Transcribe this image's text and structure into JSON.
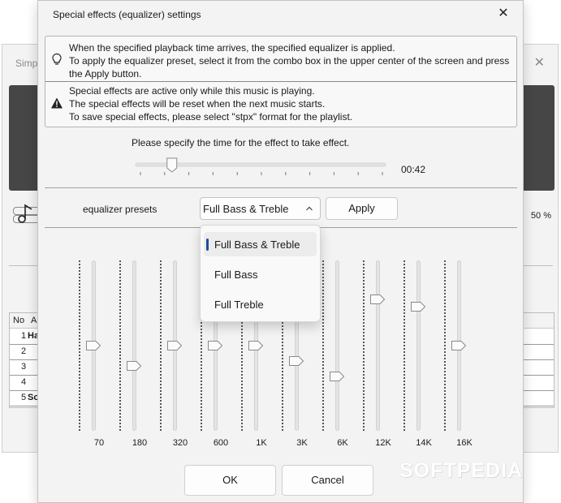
{
  "background_window": {
    "title": "Simpl",
    "close_glyph": "✕",
    "volume_percent": "50 %",
    "table": {
      "headers": [
        "No",
        "Ar"
      ],
      "rows": [
        {
          "no": "1",
          "name": "Ha"
        },
        {
          "no": "2",
          "name": ""
        },
        {
          "no": "3",
          "name": ""
        },
        {
          "no": "4",
          "name": ""
        },
        {
          "no": "5",
          "name": "So"
        }
      ]
    }
  },
  "dialog": {
    "title": "Special effects (equalizer) settings",
    "close_glyph": "✕",
    "info": {
      "section1": [
        "When the specified playback time arrives, the specified equalizer is applied.",
        "To apply the equalizer preset, select it from the combo box in the upper center of the screen and press",
        "the Apply button."
      ],
      "section2": [
        "Special effects are active only while this music is playing.",
        "The special effects will be reset when the next music starts.",
        "To save special effects, please select \"stpx\" format for the playlist."
      ]
    },
    "time": {
      "label": "Please specify the time for the effect to take effect.",
      "value": "00:42",
      "slider_fraction": 0.13
    },
    "preset": {
      "label": "equalizer presets",
      "selected": "Full Bass & Treble",
      "apply_label": "Apply",
      "options": [
        "Full Bass & Treble",
        "Full Bass",
        "Full Treble"
      ]
    },
    "equalizer": {
      "bands": [
        {
          "label": "70",
          "level": 0.5
        },
        {
          "label": "180",
          "level": 0.38
        },
        {
          "label": "320",
          "level": 0.5
        },
        {
          "label": "600",
          "level": 0.5
        },
        {
          "label": "1K",
          "level": 0.5
        },
        {
          "label": "3K",
          "level": 0.41
        },
        {
          "label": "6K",
          "level": 0.32
        },
        {
          "label": "12K",
          "level": 0.77
        },
        {
          "label": "14K",
          "level": 0.73
        },
        {
          "label": "16K",
          "level": 0.5
        }
      ]
    },
    "buttons": {
      "ok": "OK",
      "cancel": "Cancel"
    }
  },
  "watermark": "SOFTPEDIA",
  "colors": {
    "accent": "#1f4d9a",
    "dialog_bg": "#f3f3f3",
    "display_bg": "#464646"
  }
}
